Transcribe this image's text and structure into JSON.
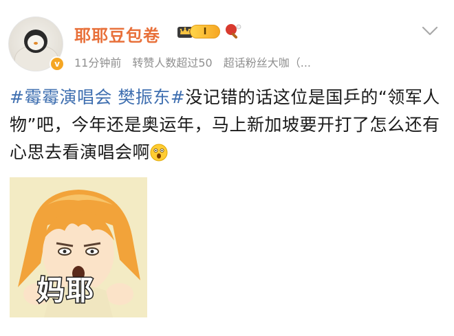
{
  "post": {
    "author": {
      "name": "耶耶豆包卷",
      "level_badge": "I",
      "verified_mark": "v"
    },
    "meta": {
      "time": "11分钟前",
      "reposts": "转赞人数超过50",
      "tag": "超话粉丝大咖（..."
    },
    "content": {
      "hashtag_1": "#霉霉演唱会 樊振东#",
      "text": "没记错的话这位是国乒的“领军人物”吧，今年还是奥运年，马上新加坡要开打了怎么还有心思去看演唱会啊"
    },
    "sticker": {
      "caption": "妈耶"
    }
  },
  "icons": {
    "crown": "crown-icon",
    "pingpong": "pingpong-icon",
    "chevron": "chevron-down-icon",
    "emoji": "shocked-face-emoji",
    "verified": "verified-badge"
  },
  "colors": {
    "username": "#e8703a",
    "hashtag": "#3f6fb0",
    "meta": "#8f8f8f",
    "verified": "#f5a623"
  }
}
